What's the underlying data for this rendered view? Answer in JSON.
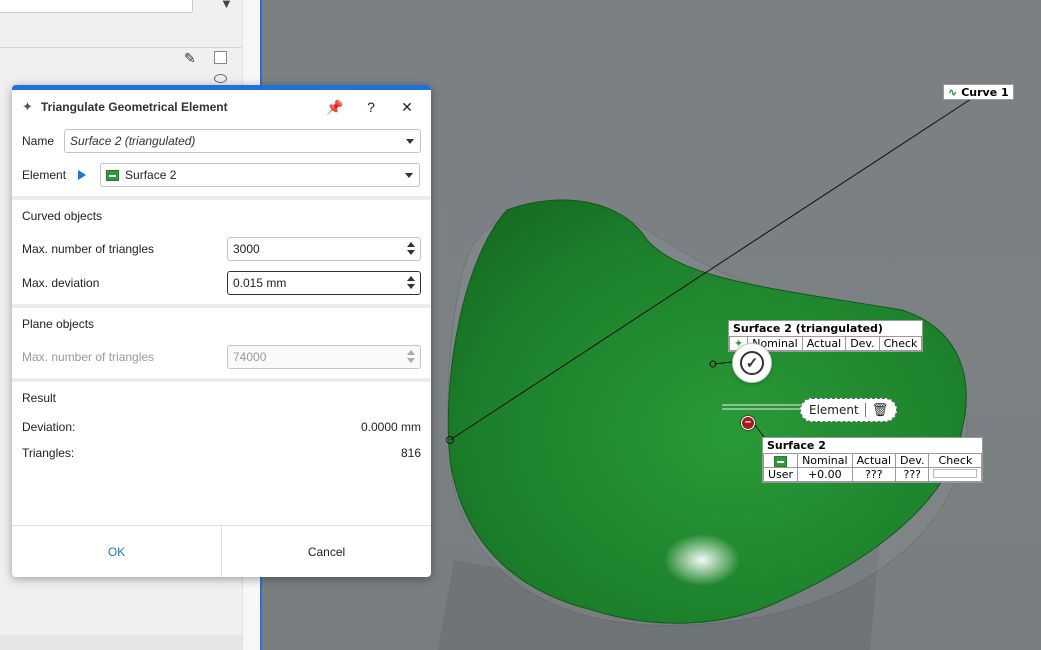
{
  "dialog": {
    "title": "Triangulate Geometrical Element",
    "pin_label": "📌",
    "help_label": "?",
    "close_label": "✕",
    "name_label": "Name",
    "name_value": "Surface 2 (triangulated)",
    "element_label": "Element",
    "element_value": "Surface 2",
    "curved_section_title": "Curved objects",
    "curved_max_triangles_label": "Max. number of triangles",
    "curved_max_triangles_value": "3000",
    "max_deviation_label": "Max. deviation",
    "max_deviation_value": "0.015 mm",
    "plane_section_title": "Plane objects",
    "plane_max_triangles_label": "Max. number of triangles",
    "plane_max_triangles_value": "74000",
    "result_section_title": "Result",
    "deviation_label": "Deviation:",
    "deviation_value": "0.0000 mm",
    "triangles_label": "Triangles:",
    "triangles_value": "816",
    "ok_label": "OK",
    "cancel_label": "Cancel"
  },
  "viewport": {
    "curve_label": "Curve 1",
    "triangulated_table": {
      "title": "Surface 2 (triangulated)",
      "headers": [
        "Nominal",
        "Actual",
        "Dev.",
        "Check"
      ]
    },
    "surface_table": {
      "title": "Surface 2",
      "headers": [
        "Nominal",
        "Actual",
        "Dev.",
        "Check"
      ],
      "row": [
        "User",
        "+0.00",
        "???",
        "???"
      ]
    },
    "element_pill_label": "Element",
    "surface_color": "#1f8a2e",
    "accent_color": "#1e73d8"
  }
}
